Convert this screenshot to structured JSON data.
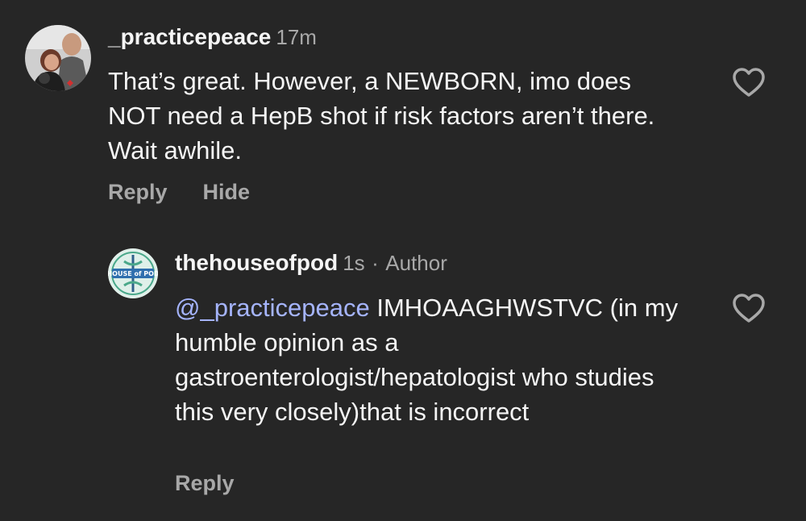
{
  "comments": [
    {
      "username": "_practicepeace",
      "time": "17m",
      "text": "That’s great. However, a NEWBORN, imo does NOT need a HepB shot if risk factors aren’t there. Wait awhile.",
      "actions": {
        "reply": "Reply",
        "hide": "Hide"
      },
      "avatar_icon": "user-photo-avatar"
    },
    {
      "username": "thehouseofpod",
      "time": "1s",
      "separator": "·",
      "badge": "Author",
      "mention": "@_practicepeace",
      "text": "IMHOAAGHWSTVC (in my humble opinion as a gastroenterologist/hepatologist who studies this very closely)that is incorrect",
      "actions": {
        "reply": "Reply"
      },
      "avatar_icon": "house-of-pod-logo",
      "avatar_logo_text": "HOUSE of POD"
    }
  ],
  "colors": {
    "background": "#262626",
    "primary_text": "#f5f5f5",
    "secondary_text": "#a8a8a8",
    "mention": "#a5b4fc"
  },
  "icons": {
    "like": "heart-outline-icon"
  }
}
